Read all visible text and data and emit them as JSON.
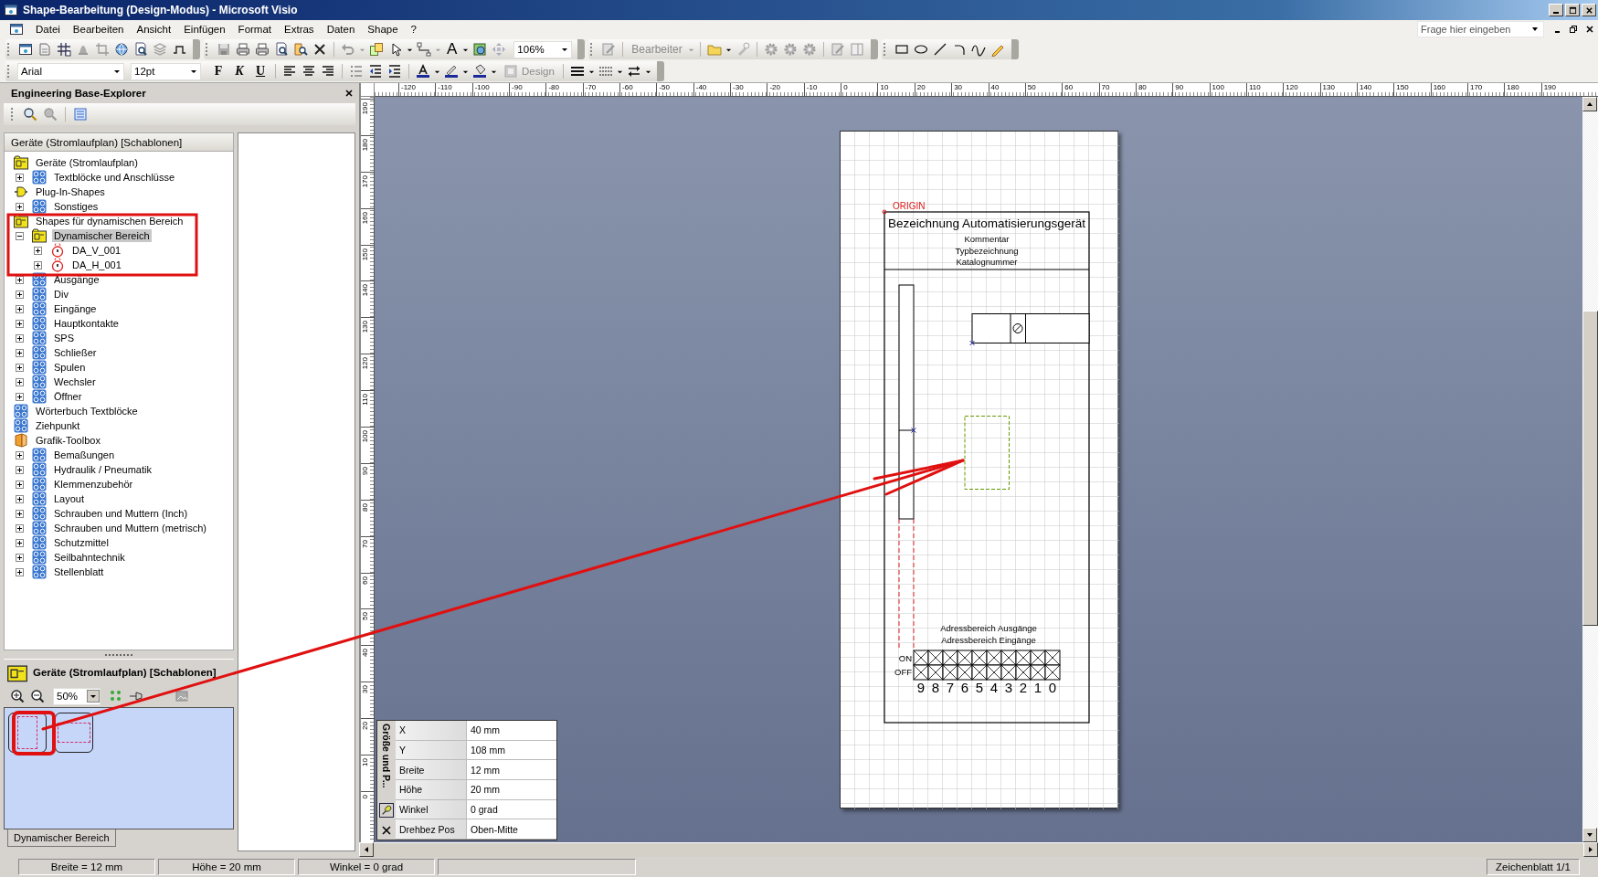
{
  "window": {
    "title": "Shape-Bearbeitung (Design-Modus) - Microsoft Visio"
  },
  "menu": [
    "Datei",
    "Bearbeiten",
    "Ansicht",
    "Einfügen",
    "Format",
    "Extras",
    "Daten",
    "Shape",
    "?"
  ],
  "help_search": {
    "placeholder": "Frage hier eingeben"
  },
  "toolbar": {
    "text_tool": "A",
    "zoom": "106%",
    "reviewer": "Bearbeiter",
    "font": "Arial",
    "font_size": "12pt",
    "bold": "F",
    "italic": "K",
    "underline": "U",
    "design": "Design"
  },
  "explorer": {
    "title": "Engineering Base-Explorer",
    "tree_header": "Geräte (Stromlaufplan) [Schablonen]",
    "tree": [
      {
        "label": "Geräte (Stromlaufplan)",
        "kind": "folder",
        "selected": false,
        "children": [
          {
            "label": "Textblöcke und Anschlüsse",
            "kind": "stencil",
            "selected": false,
            "expanded": false
          }
        ]
      },
      {
        "label": "Plug-In-Shapes",
        "kind": "plugin",
        "selected": false,
        "children": [
          {
            "label": "Sonstiges",
            "kind": "stencil",
            "selected": false,
            "expanded": false
          }
        ]
      },
      {
        "label": "Shapes für dynamischen Bereich",
        "kind": "folder",
        "selected": false,
        "children": [
          {
            "label": "Dynamischer Bereich",
            "kind": "folder",
            "selected": true,
            "expanded": true,
            "children": [
              {
                "label": "DA_V_001",
                "kind": "shape",
                "selected": false,
                "expanded": false
              },
              {
                "label": "DA_H_001",
                "kind": "shape",
                "selected": false,
                "expanded": false
              }
            ]
          },
          {
            "label": "Ausgänge",
            "kind": "stencil",
            "selected": false,
            "expanded": false
          },
          {
            "label": "Div",
            "kind": "stencil",
            "selected": false,
            "expanded": false
          },
          {
            "label": "Eingänge",
            "kind": "stencil",
            "selected": false,
            "expanded": false
          },
          {
            "label": "Hauptkontakte",
            "kind": "stencil",
            "selected": false,
            "expanded": false
          },
          {
            "label": "SPS",
            "kind": "stencil",
            "selected": false,
            "expanded": false
          },
          {
            "label": "Schließer",
            "kind": "stencil",
            "selected": false,
            "expanded": false
          },
          {
            "label": "Spulen",
            "kind": "stencil",
            "selected": false,
            "expanded": false
          },
          {
            "label": "Wechsler",
            "kind": "stencil",
            "selected": false,
            "expanded": false
          },
          {
            "label": "Öffner",
            "kind": "stencil",
            "selected": false,
            "expanded": false
          }
        ]
      },
      {
        "label": "Wörterbuch Textblöcke",
        "kind": "stencil",
        "selected": false
      },
      {
        "label": "Ziehpunkt",
        "kind": "stencil",
        "selected": false
      },
      {
        "label": "Grafik-Toolbox",
        "kind": "toolbox",
        "selected": false,
        "children": [
          {
            "label": "Bemaßungen",
            "kind": "stencil",
            "selected": false,
            "expanded": false
          },
          {
            "label": "Hydraulik / Pneumatik",
            "kind": "stencil",
            "selected": false,
            "expanded": false
          },
          {
            "label": "Klemmenzubehör",
            "kind": "stencil",
            "selected": false,
            "expanded": false
          },
          {
            "label": "Layout",
            "kind": "stencil",
            "selected": false,
            "expanded": false
          },
          {
            "label": "Schrauben und Muttern (Inch)",
            "kind": "stencil",
            "selected": false,
            "expanded": false
          },
          {
            "label": "Schrauben und Muttern (metrisch)",
            "kind": "stencil",
            "selected": false,
            "expanded": false
          },
          {
            "label": "Schutzmittel",
            "kind": "stencil",
            "selected": false,
            "expanded": false
          },
          {
            "label": "Seilbahntechnik",
            "kind": "stencil",
            "selected": false,
            "expanded": false
          },
          {
            "label": "Stellenblatt",
            "kind": "stencil",
            "selected": false,
            "expanded": false
          }
        ]
      }
    ]
  },
  "stencil": {
    "title": "Geräte (Stromlaufplan) [Schablonen]",
    "zoom": "50%",
    "shapes": [
      {
        "kind": "vertical"
      },
      {
        "kind": "horizontal"
      }
    ],
    "tab": "Dynamischer Bereich"
  },
  "ruler": {
    "horizontal": [
      "-120",
      "-110",
      "-100",
      "-90",
      "-80",
      "-70",
      "-60",
      "-50",
      "-40",
      "-30",
      "-20",
      "-10",
      "0",
      "10",
      "20",
      "30",
      "40",
      "50",
      "60",
      "70",
      "80",
      "90",
      "100",
      "110",
      "120",
      "130",
      "140",
      "150",
      "160",
      "170",
      "180",
      "190"
    ],
    "vertical": [
      "190",
      "180",
      "170",
      "160",
      "150",
      "140",
      "130",
      "120",
      "110",
      "100",
      "90",
      "80",
      "70",
      "60",
      "50",
      "40",
      "30",
      "20",
      "10",
      "0"
    ]
  },
  "drawing": {
    "origin": "ORIGIN",
    "title": "Bezeichnung Automatisierungsgerät",
    "info": [
      "Kommentar",
      "Typbezeichnung",
      "Katalognummer"
    ],
    "address": [
      "Adressbereich Ausgänge",
      "Adressbereich Eingänge"
    ],
    "rows": [
      "ON",
      "OFF"
    ],
    "bits": [
      "9",
      "8",
      "7",
      "6",
      "5",
      "4",
      "3",
      "2",
      "1",
      "0"
    ]
  },
  "size_position": {
    "title": "Größe und P...",
    "rows": [
      {
        "label": "X",
        "value": "40 mm"
      },
      {
        "label": "Y",
        "value": "108 mm"
      },
      {
        "label": "Breite",
        "value": "12 mm"
      },
      {
        "label": "Höhe",
        "value": "20 mm"
      },
      {
        "label": "Winkel",
        "value": "0 grad"
      },
      {
        "label": "Drehbez Pos",
        "value": "Oben-Mitte"
      }
    ]
  },
  "status_bar": {
    "fields": [
      "Breite = 12 mm",
      "Höhe = 20 mm",
      "Winkel = 0 grad"
    ],
    "page": "Zeichenblatt 1/1"
  }
}
